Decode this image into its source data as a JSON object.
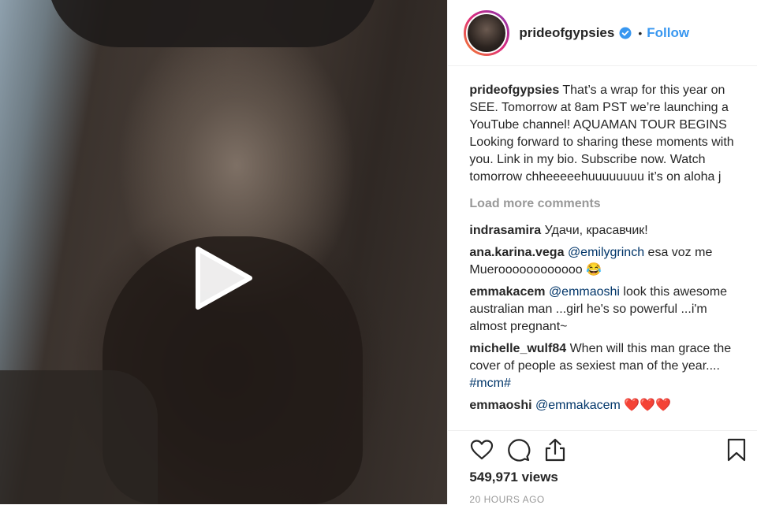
{
  "media": {
    "play_icon": "play-icon"
  },
  "header": {
    "username": "prideofgypsies",
    "separator": "•",
    "follow_label": "Follow"
  },
  "caption": {
    "username": "prideofgypsies",
    "text": "That’s a wrap for this year on SEE. Tomorrow at 8am PST we’re launching a YouTube channel!  AQUAMAN TOUR BEGINS Looking forward to sharing these moments with you. Link in my bio. Subscribe now. Watch tomorrow chheeeeehuuuuuuuu it’s on aloha j"
  },
  "load_more_label": "Load more comments",
  "comments": [
    {
      "user": "indrasamira",
      "mention": "",
      "text": "Удачи, красавчик!"
    },
    {
      "user": "ana.karina.vega",
      "mention": "@emilygrinch",
      "text": " esa voz me Mueroooooooooooo 😂"
    },
    {
      "user": "emmakacem",
      "mention": "@emmaoshi",
      "text": " look this awesome australian man ...girl he's so powerful ...i'm almost pregnant~"
    },
    {
      "user": "michelle_wulf84",
      "mention": "",
      "text": "When will this man grace the cover of people as sexiest man of the year.... ",
      "tag": "#mcm#"
    },
    {
      "user": "emmaoshi",
      "mention": "@emmakacem",
      "text": " ❤️❤️❤️"
    }
  ],
  "actions": {
    "like_icon": "heart-icon",
    "comment_icon": "comment-icon",
    "share_icon": "share-icon",
    "save_icon": "bookmark-icon"
  },
  "views": "549,971 views",
  "timestamp": "20 HOURS AGO",
  "colors": {
    "link": "#3897f0",
    "mention": "#003569",
    "muted": "#999999",
    "text": "#262626"
  }
}
